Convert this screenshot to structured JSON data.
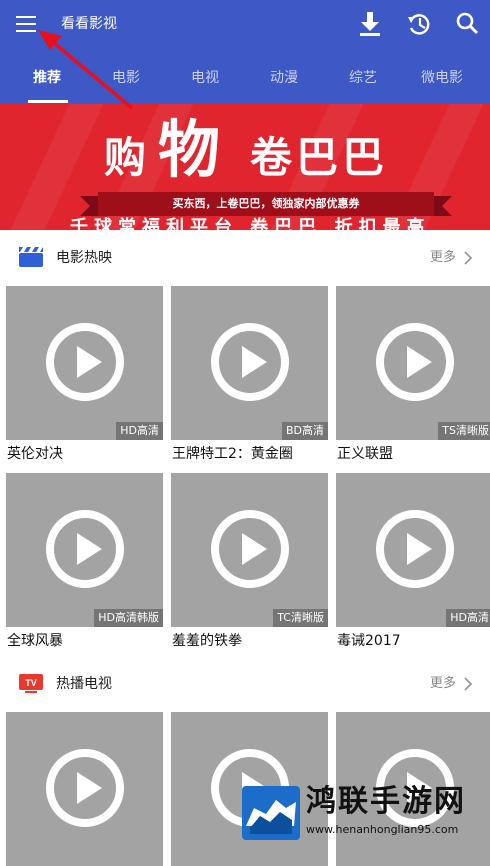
{
  "app": {
    "title": "看看影视"
  },
  "toolbar": {
    "menu_icon": "hamburger-menu-icon",
    "download_icon": "download-icon",
    "history_icon": "history-icon",
    "search_icon": "search-icon"
  },
  "tabs": [
    {
      "label": "推荐",
      "active": true
    },
    {
      "label": "电影",
      "active": false
    },
    {
      "label": "电视",
      "active": false
    },
    {
      "label": "动漫",
      "active": false
    },
    {
      "label": "综艺",
      "active": false
    },
    {
      "label": "微电影",
      "active": false
    }
  ],
  "banner": {
    "title_left": "购",
    "title_big": "物",
    "title_right": "卷巴巴",
    "ribbon_text": "买东西，上卷巴巴，领独家内部优惠券",
    "subtitle": "千球常福利平台 卷巴巴 折扣最高"
  },
  "sections": [
    {
      "title": "电影热映",
      "more": "更多",
      "icon": "clapperboard-icon",
      "items": [
        {
          "title": "英伦对决",
          "quality": "HD高清"
        },
        {
          "title": "王牌特工2：黄金圈",
          "quality": "BD高清"
        },
        {
          "title": "正义联盟",
          "quality": "TS清晰版"
        },
        {
          "title": "全球风暴",
          "quality": "HD高清韩版"
        },
        {
          "title": "羞羞的铁拳",
          "quality": "TC清晰版"
        },
        {
          "title": "毒诫2017",
          "quality": "HD高清"
        }
      ]
    },
    {
      "title": "热播电视",
      "more": "更多",
      "icon": "tv-icon",
      "icon_text": "TV",
      "items": [
        {},
        {},
        {}
      ]
    }
  ],
  "watermark": {
    "text": "鸿联手游网",
    "url": "www.henanhonglian95.com"
  },
  "colors": {
    "primary": "#3e58c6",
    "banner_red": "#e0252f",
    "thumb_gray": "#a3a3a3",
    "section_icon_blue": "#2f5fd6",
    "section_icon_red": "#e8392e"
  }
}
